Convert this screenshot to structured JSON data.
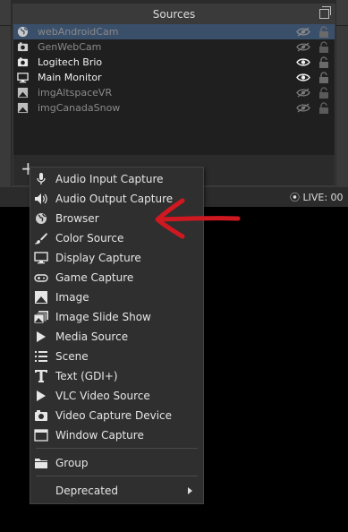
{
  "sources_panel": {
    "title": "Sources",
    "items": [
      {
        "label": "webAndroidCam",
        "type": "browser",
        "visible": false,
        "locked": false,
        "selected": true
      },
      {
        "label": "GenWebCam",
        "type": "camera",
        "visible": false,
        "locked": false,
        "selected": false
      },
      {
        "label": "Logitech Brio",
        "type": "camera",
        "visible": true,
        "locked": false,
        "selected": false
      },
      {
        "label": "Main Monitor",
        "type": "monitor",
        "visible": true,
        "locked": false,
        "selected": false
      },
      {
        "label": "imgAltspaceVR",
        "type": "image",
        "visible": false,
        "locked": false,
        "selected": false
      },
      {
        "label": "imgCanadaSnow",
        "type": "image",
        "visible": false,
        "locked": false,
        "selected": false
      }
    ],
    "add_button": "+"
  },
  "status_bar": {
    "live_label": "LIVE: 00"
  },
  "context_menu": {
    "items": [
      {
        "label": "Audio Input Capture",
        "icon": "microphone-icon"
      },
      {
        "label": "Audio Output Capture",
        "icon": "speaker-icon"
      },
      {
        "label": "Browser",
        "icon": "globe-icon"
      },
      {
        "label": "Color Source",
        "icon": "brush-icon"
      },
      {
        "label": "Display Capture",
        "icon": "monitor-icon"
      },
      {
        "label": "Game Capture",
        "icon": "gamepad-icon"
      },
      {
        "label": "Image",
        "icon": "image-icon"
      },
      {
        "label": "Image Slide Show",
        "icon": "slideshow-icon"
      },
      {
        "label": "Media Source",
        "icon": "play-icon"
      },
      {
        "label": "Scene",
        "icon": "list-icon"
      },
      {
        "label": "Text (GDI+)",
        "icon": "text-icon"
      },
      {
        "label": "VLC Video Source",
        "icon": "play-icon"
      },
      {
        "label": "Video Capture Device",
        "icon": "camera-icon"
      },
      {
        "label": "Window Capture",
        "icon": "window-icon"
      }
    ],
    "group_label": "Group",
    "deprecated_label": "Deprecated"
  },
  "annotation": {
    "color": "#d01820"
  }
}
